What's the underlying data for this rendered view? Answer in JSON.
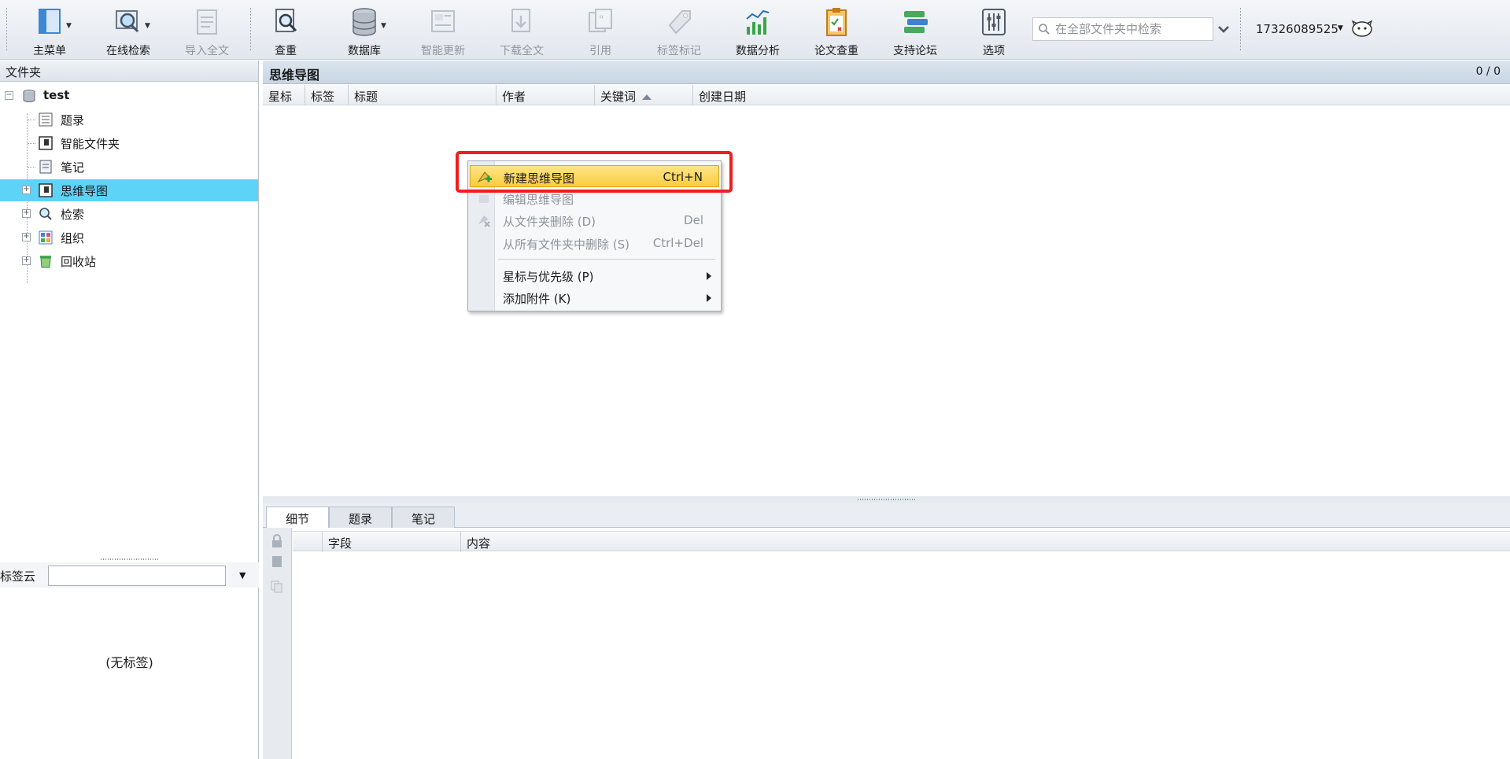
{
  "toolbar": {
    "items": [
      {
        "label": "主菜单",
        "icon": "main-menu-icon",
        "has_dropdown": true
      },
      {
        "label": "在线检索",
        "icon": "online-search-icon",
        "has_dropdown": true
      },
      {
        "label": "导入全文",
        "icon": "import-fulltext-icon",
        "disabled": true
      },
      {
        "label": "查重",
        "icon": "duplicate-check-icon"
      },
      {
        "label": "数据库",
        "icon": "database-icon",
        "has_dropdown": true
      },
      {
        "label": "智能更新",
        "icon": "smart-update-icon",
        "disabled": true
      },
      {
        "label": "下载全文",
        "icon": "download-fulltext-icon",
        "disabled": true
      },
      {
        "label": "引用",
        "icon": "cite-icon",
        "disabled": true
      },
      {
        "label": "标签标记",
        "icon": "tag-mark-icon",
        "disabled": true
      },
      {
        "label": "数据分析",
        "icon": "data-analysis-icon"
      },
      {
        "label": "论文查重",
        "icon": "paper-check-icon"
      },
      {
        "label": "支持论坛",
        "icon": "support-forum-icon"
      },
      {
        "label": "选项",
        "icon": "options-icon"
      }
    ],
    "search_placeholder": "在全部文件夹中检索",
    "user": "17326089525"
  },
  "left_panel": {
    "header": "文件夹",
    "tree": {
      "root": "test",
      "items": [
        "题录",
        "智能文件夹",
        "笔记",
        "思维导图",
        "检索",
        "组织",
        "回收站"
      ],
      "selected": "思维导图"
    },
    "tag_cloud_label": "标签云",
    "no_tags": "(无标签)"
  },
  "main": {
    "title": "思维导图",
    "count": "0 / 0",
    "columns": [
      "星标",
      "标签",
      "标题",
      "作者",
      "关键词",
      "创建日期"
    ]
  },
  "context_menu": {
    "items": [
      {
        "label": "新建思维导图",
        "shortcut": "Ctrl+N",
        "highlighted": true
      },
      {
        "label": "编辑思维导图",
        "shortcut": "",
        "disabled": true
      },
      {
        "label": "从文件夹删除 (D)",
        "shortcut": "Del",
        "disabled": true
      },
      {
        "label": "从所有文件夹中删除 (S)",
        "shortcut": "Ctrl+Del",
        "disabled": true
      },
      {
        "label": "星标与优先级 (P)",
        "submenu": true
      },
      {
        "label": "添加附件 (K)",
        "submenu": true
      }
    ]
  },
  "detail": {
    "tabs": [
      "细节",
      "题录",
      "笔记"
    ],
    "columns": [
      "字段",
      "内容"
    ]
  },
  "colors": {
    "selection": "#5fd2f8",
    "highlight_box": "#f21d1d",
    "menu_highlight": "#f9cc40"
  }
}
